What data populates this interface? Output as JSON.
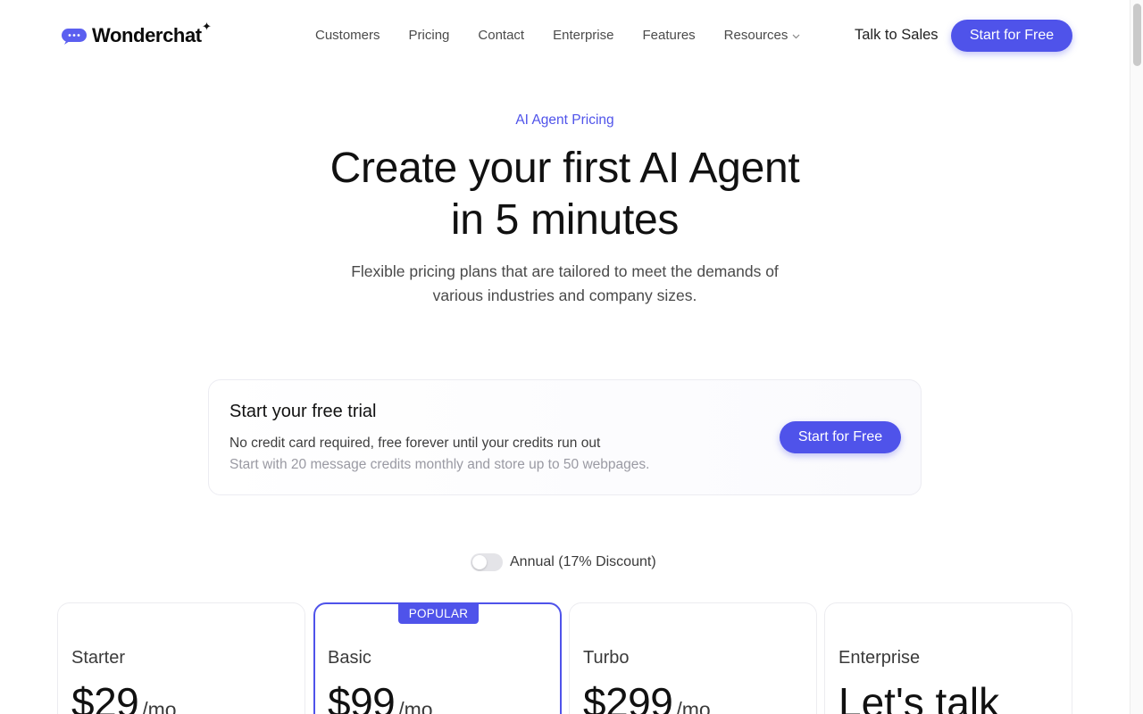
{
  "brand": {
    "name": "Wonderchat",
    "spark": "✦",
    "accent_color": "#4f53ea"
  },
  "nav": {
    "items": [
      {
        "label": "Customers"
      },
      {
        "label": "Pricing"
      },
      {
        "label": "Contact"
      },
      {
        "label": "Enterprise"
      },
      {
        "label": "Features"
      },
      {
        "label": "Resources",
        "icon": "chevron-down-icon"
      }
    ],
    "talk_to_sales": "Talk to Sales",
    "cta": "Start for Free"
  },
  "hero": {
    "eyebrow": "AI Agent Pricing",
    "title_line1": "Create your first AI Agent",
    "title_line2": "in 5 minutes",
    "subtitle_line1": "Flexible pricing plans that are tailored to meet the demands of",
    "subtitle_line2": "various industries and company sizes."
  },
  "trial": {
    "title": "Start your free trial",
    "line1": "No credit card required, free forever until your credits run out",
    "line2": "Start with 20 message credits monthly and store up to 50 webpages.",
    "cta": "Start for Free"
  },
  "billing_toggle": {
    "label": "Annual (17% Discount)",
    "on": false
  },
  "plans": [
    {
      "name": "Starter",
      "price": "$29",
      "period": "/mo"
    },
    {
      "name": "Basic",
      "price": "$99",
      "period": "/mo",
      "badge": "POPULAR"
    },
    {
      "name": "Turbo",
      "price": "$299",
      "period": "/mo"
    },
    {
      "name": "Enterprise",
      "price_text": "Let's talk"
    }
  ]
}
